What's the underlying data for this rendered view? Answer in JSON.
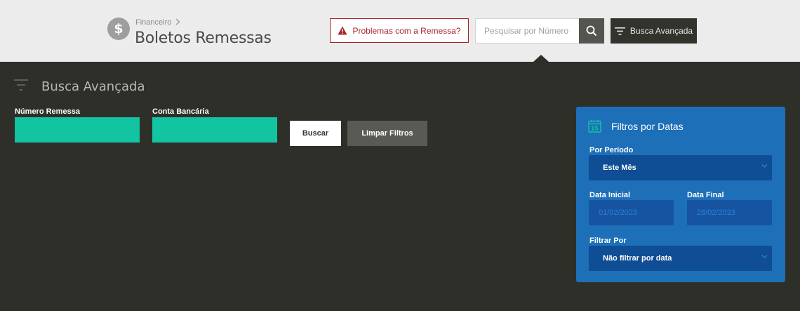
{
  "header": {
    "logo_symbol": "$",
    "breadcrumb_parent": "Financeiro",
    "title": "Boletos Remessas",
    "problem_button": "Problemas com a Remessa?",
    "search_placeholder": "Pesquisar por Número d",
    "advanced_button": "Busca Avançada"
  },
  "panel": {
    "title": "Busca Avançada",
    "fields": [
      {
        "label": "Número Remessa",
        "value": ""
      },
      {
        "label": "Conta Bancária",
        "value": ""
      }
    ],
    "search_button": "Buscar",
    "clear_button": "Limpar Filtros"
  },
  "date_filters": {
    "title": "Filtros por Datas",
    "calendar_day": "15",
    "period_label": "Por Período",
    "period_value": "Este Mês",
    "start_label": "Data Inicial",
    "start_value": "01/02/2023",
    "end_label": "Data Final",
    "end_value": "28/02/2023",
    "filter_by_label": "Filtrar Por",
    "filter_by_value": "Não filtrar por data"
  },
  "colors": {
    "accent_teal": "#13c4a3",
    "alert_red": "#a8232f",
    "card_blue": "#1d6fb8",
    "panel_bg": "#2f2f2a"
  },
  "icons": [
    "warning-icon",
    "search-icon",
    "filter-icon",
    "calendar-icon",
    "chevron-right-icon",
    "chevron-down-icon"
  ]
}
